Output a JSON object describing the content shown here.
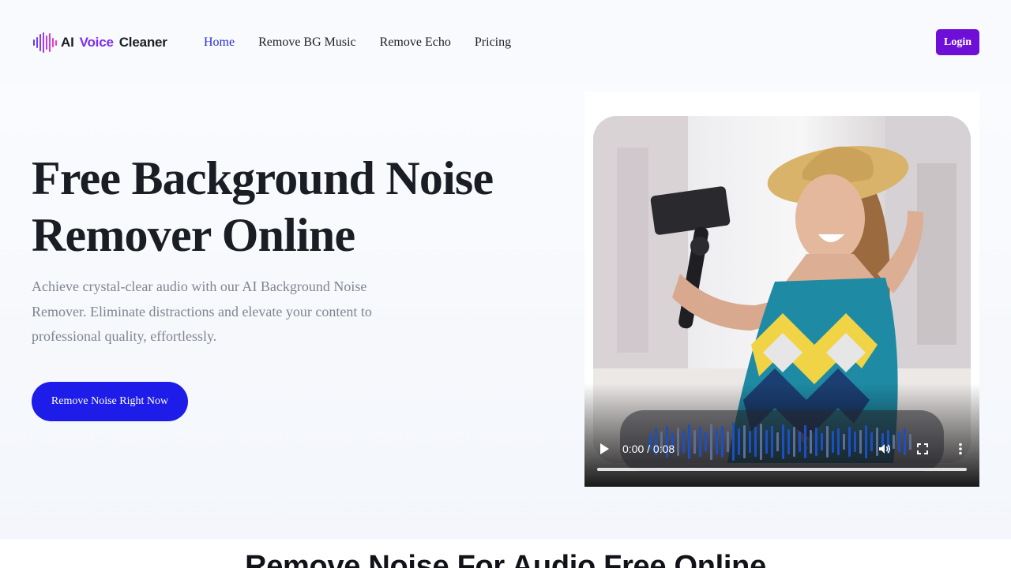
{
  "header": {
    "logo": {
      "part1": "AI",
      "part2": "Voice",
      "part3": "Cleaner",
      "icon": "soundwave-icon"
    },
    "nav": [
      {
        "label": "Home",
        "active": true
      },
      {
        "label": "Remove BG Music",
        "active": false
      },
      {
        "label": "Remove Echo",
        "active": false
      },
      {
        "label": "Pricing",
        "active": false
      }
    ],
    "login_label": "Login"
  },
  "hero": {
    "title_line1": "Free Background Noise",
    "title_line2": "Remover Online",
    "description": "Achieve crystal-clear audio with our AI Background Noise Remover. Eliminate distractions and elevate your content to professional quality, effortlessly.",
    "cta_label": "Remove Noise Right Now"
  },
  "video": {
    "time": "0:00 / 0:08",
    "progress": 0,
    "icons": [
      "play-icon",
      "volume-icon",
      "fullscreen-icon",
      "more-vertical-icon"
    ]
  },
  "section2": {
    "title": "Remove Noise For Audio Free Online"
  },
  "colors": {
    "accent": "#1d1ce9",
    "login": "#6d0fd6",
    "nav_active": "#2a2dd8",
    "logo_voice": "#7b2ff7"
  }
}
